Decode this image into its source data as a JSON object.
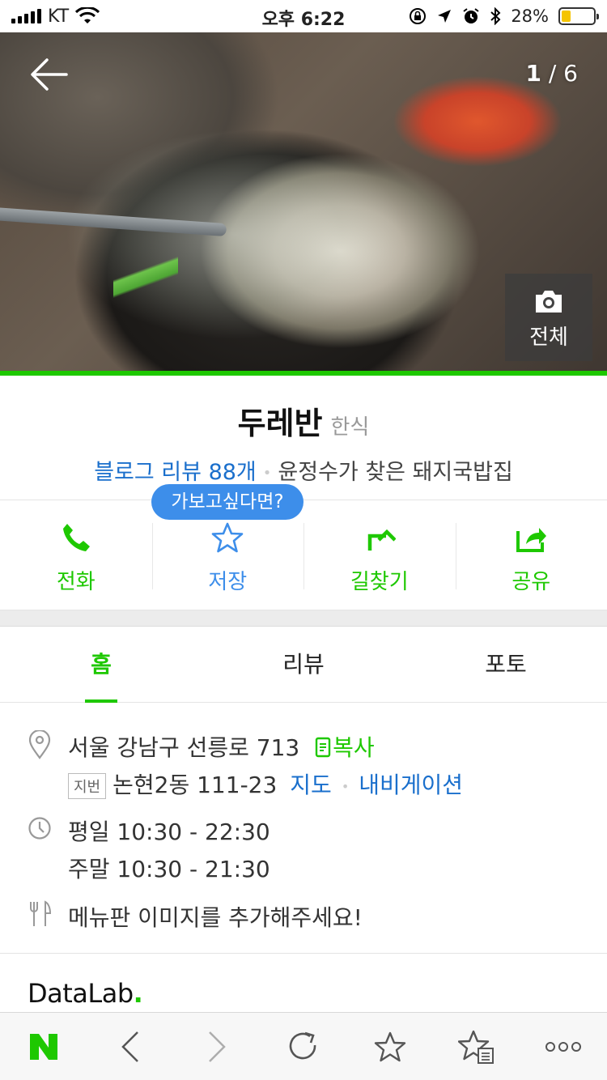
{
  "status_bar": {
    "carrier": "KT",
    "time": "오후 6:22",
    "battery": "28%",
    "battery_level": 0.28
  },
  "hero": {
    "counter_current": "1",
    "counter_sep": " / ",
    "counter_total": "6",
    "all_photos_label": "전체"
  },
  "place": {
    "name": "두레반",
    "category": "한식",
    "blog_review": "블로그 리뷰 88개",
    "tagline": "윤정수가 찾은 돼지국밥집"
  },
  "tooltip": "가보고싶다면?",
  "actions": [
    {
      "label": "전화",
      "icon": "phone-icon"
    },
    {
      "label": "저장",
      "icon": "star-icon"
    },
    {
      "label": "길찾기",
      "icon": "directions-icon"
    },
    {
      "label": "공유",
      "icon": "share-icon"
    }
  ],
  "tabs": [
    {
      "label": "홈",
      "active": true
    },
    {
      "label": "리뷰",
      "active": false
    },
    {
      "label": "포토",
      "active": false
    }
  ],
  "info": {
    "address": "서울 강남구 선릉로 713",
    "copy_label": "복사",
    "jibeon_badge": "지번",
    "jibeon_address": "논현2동 111-23",
    "map_link": "지도",
    "navigation_link": "내비게이션",
    "hours_weekday": "평일 10:30 - 22:30",
    "hours_weekend": "주말 10:30 - 21:30",
    "menu_prompt": "메뉴판 이미지를 추가해주세요!"
  },
  "datalab": {
    "text": "DataLab",
    "dot": "."
  },
  "colors": {
    "accent_green": "#1ec800",
    "link_blue": "#1a6fcc",
    "tooltip_blue": "#3d8eea"
  }
}
